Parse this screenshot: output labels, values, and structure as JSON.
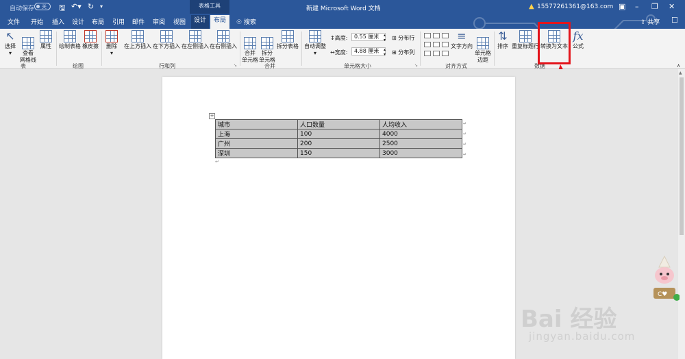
{
  "titlebar": {
    "autosave": "自动保存",
    "autosave_state": "关",
    "context_tools": "表格工具",
    "document_title": "新建 Microsoft Word 文档",
    "user": "15577261361@163.com",
    "qat_icons": [
      "save-icon",
      "undo-icon",
      "redo-icon",
      "customize-icon"
    ],
    "window_icons": [
      "ribbon-display-icon",
      "minimize-icon",
      "restore-icon",
      "close-icon"
    ]
  },
  "tabs": {
    "file": "文件",
    "home": "开始",
    "insert": "插入",
    "design_doc": "设计",
    "layout_doc": "布局",
    "references": "引用",
    "mailings": "邮件",
    "review": "审阅",
    "view": "视图",
    "table_design": "设计",
    "table_layout": "布局",
    "search": "搜索",
    "share": "共享"
  },
  "ribbon": {
    "table": {
      "select": "选择",
      "gridlines": "查看\n网格线",
      "properties": "属性",
      "group": "表"
    },
    "draw": {
      "draw_table": "绘制表格",
      "eraser": "橡皮擦",
      "group": "绘图"
    },
    "rows_cols": {
      "delete": "删除",
      "insert_above": "在上方插入",
      "insert_below": "在下方插入",
      "insert_left": "在左侧插入",
      "insert_right": "在右侧插入",
      "group": "行和列"
    },
    "merge": {
      "merge_cells": "合并\n单元格",
      "split_cells": "拆分\n单元格",
      "split_table": "拆分表格",
      "group": "合并"
    },
    "cell_size": {
      "autofit": "自动调整",
      "height_label": "高度:",
      "height_value": "0.55 厘米",
      "width_label": "宽度:",
      "width_value": "4.88 厘米",
      "distribute_rows": "分布行",
      "distribute_cols": "分布列",
      "group": "单元格大小"
    },
    "alignment": {
      "text_direction": "文字方向",
      "cell_margins": "单元格\n边距",
      "group": "对齐方式"
    },
    "data": {
      "sort": "排序",
      "repeat_header": "重复标题行",
      "convert_to_text": "转换为文本",
      "formula": "公式",
      "group": "数据"
    }
  },
  "document": {
    "table": {
      "rows": [
        [
          "城市",
          "人口数量",
          "人均收入"
        ],
        [
          "上海",
          "100",
          "4000"
        ],
        [
          "广州",
          "200",
          "2500"
        ],
        [
          "深圳",
          "150",
          "3000"
        ]
      ]
    }
  },
  "watermark": {
    "brand": "Bai 经验",
    "url": "jingyan.baidu.com"
  },
  "colors": {
    "accent": "#2b579a",
    "highlight": "#e3141b",
    "table_fill": "#c8c8c8"
  }
}
